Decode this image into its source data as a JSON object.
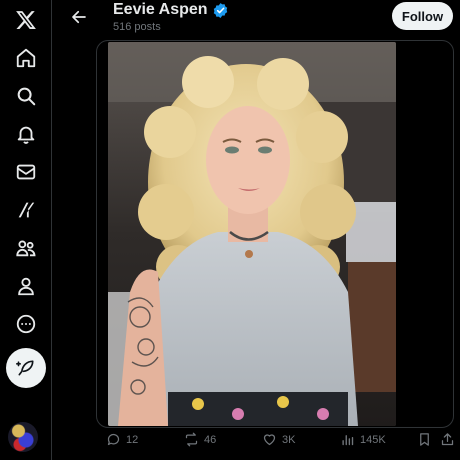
{
  "app": {
    "logo_icon": "x-logo-icon"
  },
  "sidebar": {
    "items": [
      {
        "name": "home",
        "icon": "home-icon"
      },
      {
        "name": "explore",
        "icon": "search-icon"
      },
      {
        "name": "notifications",
        "icon": "bell-icon"
      },
      {
        "name": "messages",
        "icon": "envelope-icon"
      },
      {
        "name": "grok",
        "icon": "grok-icon"
      },
      {
        "name": "communities",
        "icon": "people-icon"
      },
      {
        "name": "profile",
        "icon": "person-icon"
      },
      {
        "name": "more",
        "icon": "more-circle-icon"
      }
    ],
    "compose_icon": "feather-icon"
  },
  "header": {
    "name": "Eevie Aspen",
    "post_count": "516 posts",
    "follow_label": "Follow",
    "verified_color": "#1d9bf0"
  },
  "post": {
    "media_alt_icon": "photo",
    "replies": "12",
    "reposts": "46",
    "likes": "3K",
    "views": "145K"
  },
  "colors": {
    "background": "#000000",
    "text": "#e7e9ea",
    "muted": "#71767b",
    "accent": "#1d9bf0"
  }
}
